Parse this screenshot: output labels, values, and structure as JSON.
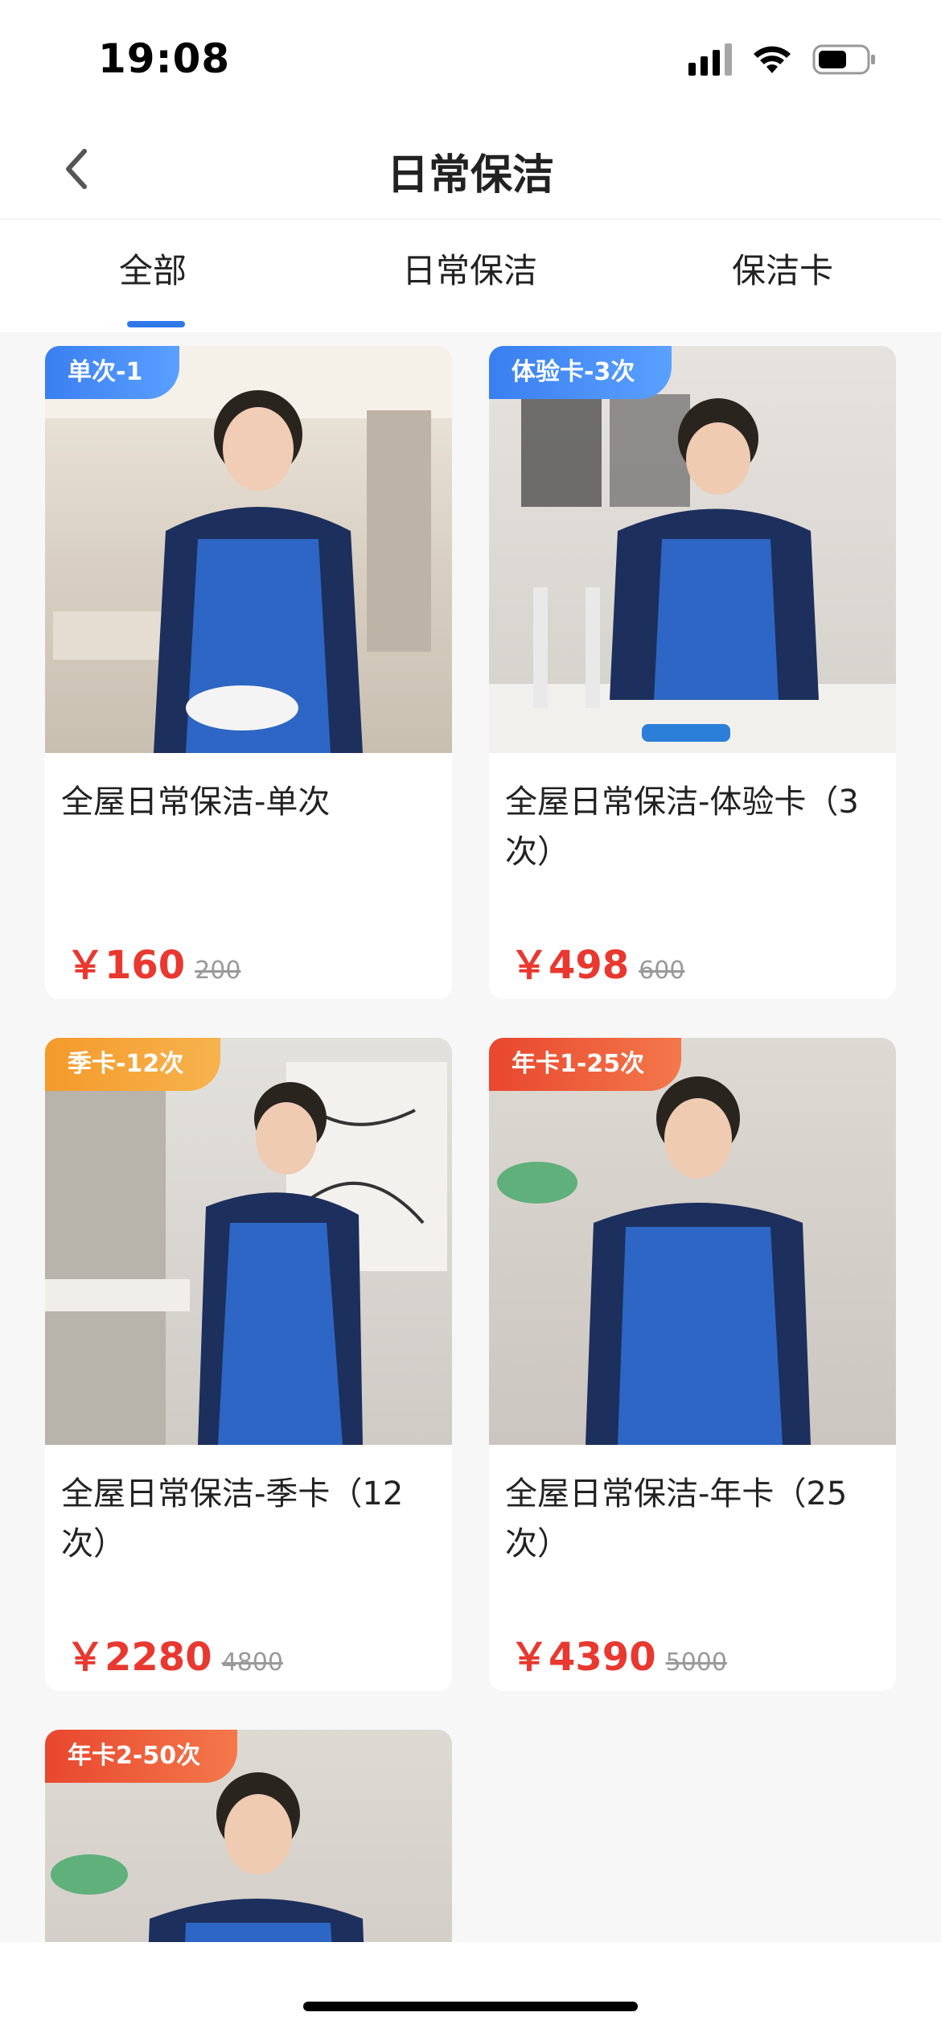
{
  "status_bar": {
    "time": "19:08",
    "icons": [
      "cellular-signal-icon",
      "wifi-icon",
      "battery-icon"
    ]
  },
  "nav": {
    "title": "日常保洁",
    "back_icon": "chevron-left-icon"
  },
  "tabs": [
    {
      "label": "全部",
      "active": true
    },
    {
      "label": "日常保洁",
      "active": false
    },
    {
      "label": "保洁卡",
      "active": false
    }
  ],
  "colors": {
    "accent_blue": "#2f77e8",
    "price_red": "#e8382f",
    "badge_blue": "#3b82f6",
    "badge_orange": "#f5a33b",
    "badge_red": "#ee5a34"
  },
  "products": [
    {
      "badge": "单次-1",
      "badge_color": "blue",
      "name": "全屋日常保洁-单次",
      "price": "￥160",
      "original_price": "200"
    },
    {
      "badge": "体验卡-3次",
      "badge_color": "blue",
      "name": "全屋日常保洁-体验卡（3次）",
      "price": "￥498",
      "original_price": "600"
    },
    {
      "badge": "季卡-12次",
      "badge_color": "orange",
      "name": "全屋日常保洁-季卡（12次）",
      "price": "￥2280",
      "original_price": "4800"
    },
    {
      "badge": "年卡1-25次",
      "badge_color": "red",
      "name": "全屋日常保洁-年卡（25次）",
      "price": "￥4390",
      "original_price": "5000"
    },
    {
      "badge": "年卡2-50次",
      "badge_color": "red"
    }
  ]
}
